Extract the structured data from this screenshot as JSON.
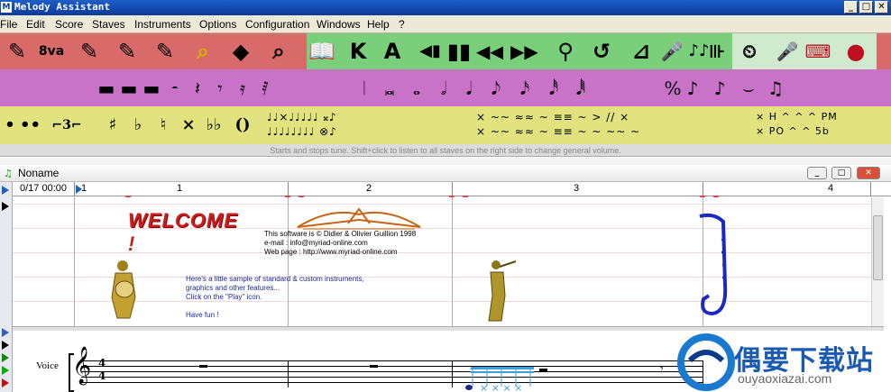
{
  "window": {
    "title": "Melody Assistant",
    "app_icon": "M",
    "min": "_",
    "max": "□",
    "close": "✕"
  },
  "menu": [
    "File",
    "Edit",
    "Score",
    "Staves",
    "Instruments",
    "Options",
    "Configuration",
    "Windows",
    "Help",
    "?"
  ],
  "toolbar1": {
    "red": [
      "✎",
      "8va",
      "✎",
      "✎",
      "✎",
      "⌕",
      "◆",
      "⌕"
    ],
    "green": [
      "📖",
      "K",
      "A",
      "◀▮",
      "▮▮",
      "◀◀",
      "▶▶",
      "⚲",
      "↺",
      "⊿",
      "🎤",
      "♪♪",
      "⊪",
      "⏲",
      "🎤",
      "⌨",
      "●"
    ]
  },
  "toolbar2": {
    "left": [
      "▬",
      "▬",
      "▬",
      "𝄼",
      "𝄽",
      "𝄾",
      "𝄿",
      "𝅀"
    ],
    "mid": [
      "𝄀",
      "𝅜",
      "𝅝",
      "𝅗𝅥",
      "𝅘𝅥",
      "𝅘𝅥𝅮",
      "𝅘𝅥𝅯",
      "𝅘𝅥𝅰",
      "𝅘𝅥𝅱"
    ],
    "right": [
      "%",
      "♪",
      "♪",
      "⌣",
      "♫"
    ]
  },
  "toolbar3": {
    "left": [
      "•",
      "••",
      "⌐3⌐",
      "♯",
      "♭",
      "♮",
      "×",
      "♭♭",
      "()"
    ],
    "mini_a": "♩♩×♩♩♩♩♩ 𝄪♪\n♩♩♩♩♩♩♩♩ ⊗♪",
    "mini_b": "× ~~ ≈≈ ~ ≡≡ ~ > // ×\n× ~~ ≈≈ ~ ≡≡ ~ ~ ~~ ~",
    "mini_c": "× H ^ ^ ^ PM\n× PO ^ ^ 5b"
  },
  "status_text": "Starts and stops tune. Shift+click to listen to all staves on the right side to change general volume.",
  "document": {
    "name": "Noname",
    "position": "0/17 00:00",
    "measures": [
      "1",
      "1",
      "2",
      "3",
      "4"
    ]
  },
  "content": {
    "welcome": "WELCOME",
    "exclaim": "!",
    "credit": "This software is © Didier & Olivier Guillion 1998\ne-mail : info@myriad-online.com\nWeb page : http://www.myriad-online.com",
    "sample_lines": [
      "Here's a little sample of standard & custom instruments,",
      "graphics and other features...",
      "Click on the \"Play\" icon.",
      "",
      "Have fun !"
    ]
  },
  "staff": {
    "label": "Voice",
    "time_top": "4",
    "time_bottom": "4",
    "clef": "𝄞"
  },
  "watermark": {
    "name": "偶要下载站",
    "url": "ouyaoxiazai.com"
  },
  "colors": {
    "title_bar": "#0a3a9a",
    "toolbar_red": "#d86a6a",
    "toolbar_green": "#7ad07a",
    "toolbar_purple": "#c873c8",
    "toolbar_yellow": "#e2e27e",
    "welcome": "#c81e1e",
    "link_text": "#1c2aa0"
  }
}
